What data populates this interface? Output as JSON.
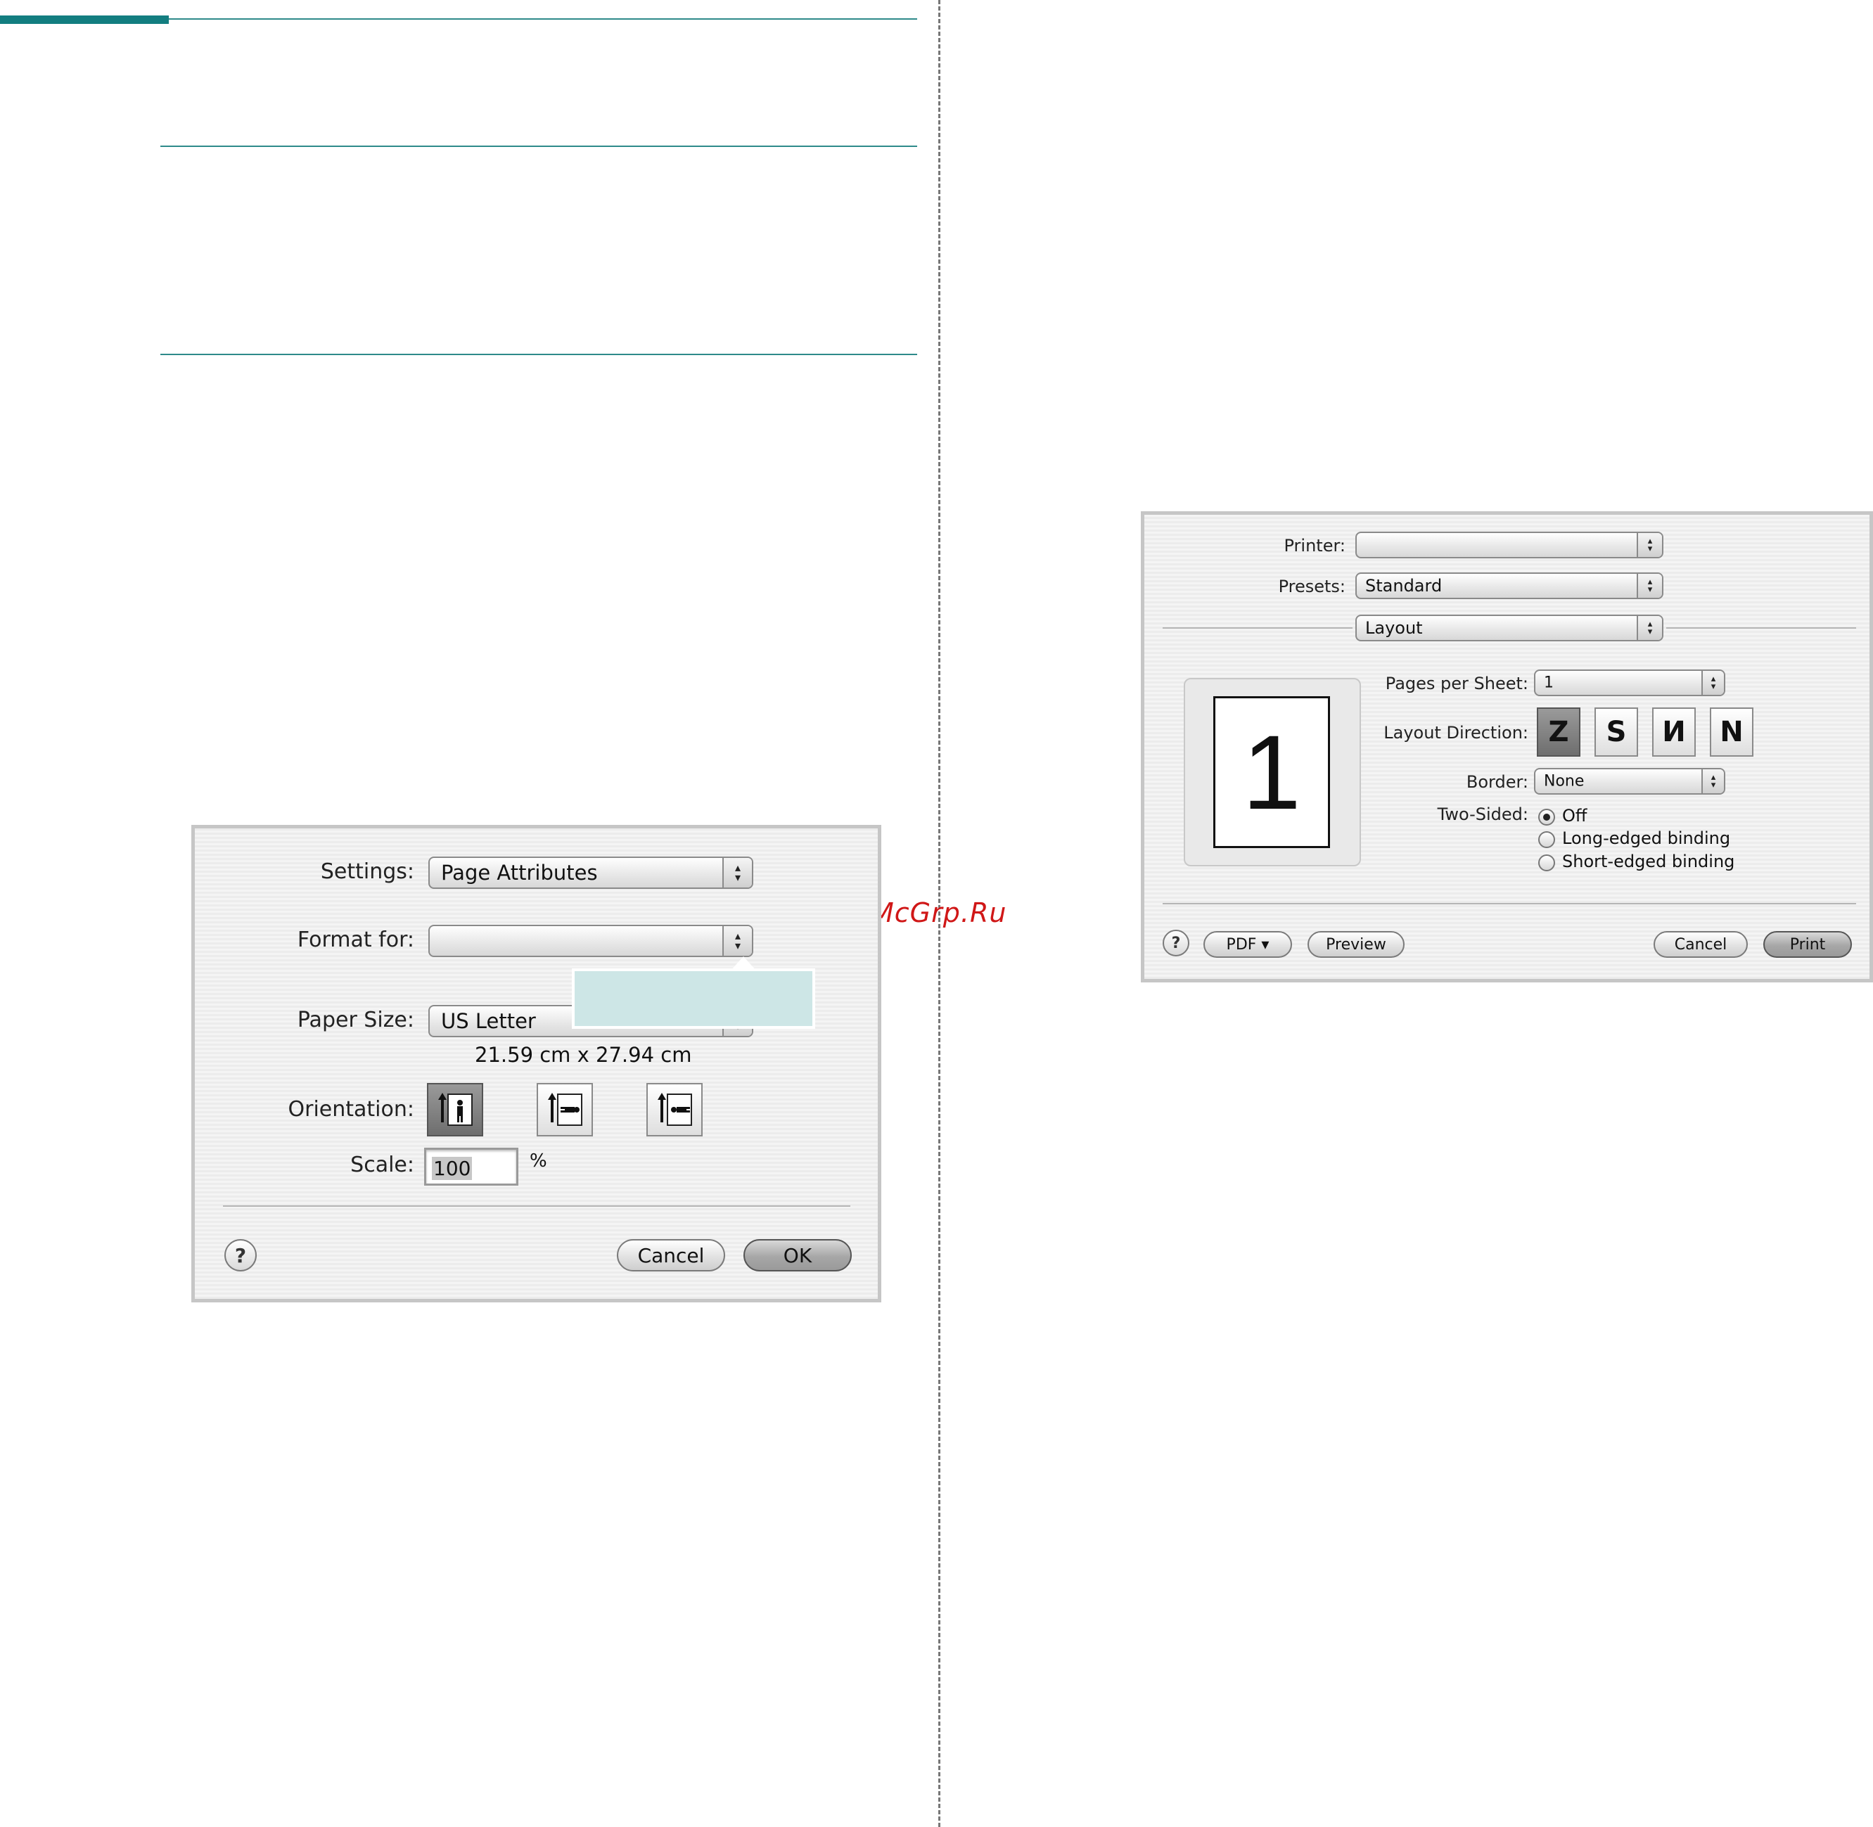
{
  "watermark": "McGrp.Ru",
  "page_setup": {
    "settings_label": "Settings:",
    "settings_value": "Page Attributes",
    "format_for_label": "Format for:",
    "format_for_value": "",
    "paper_size_label": "Paper Size:",
    "paper_size_value": "US Letter",
    "paper_dimensions": "21.59 cm x 27.94 cm",
    "orientation_label": "Orientation:",
    "scale_label": "Scale:",
    "scale_value": "100",
    "scale_unit": "%",
    "help": "?",
    "cancel": "Cancel",
    "ok": "OK"
  },
  "print_dialog": {
    "printer_label": "Printer:",
    "printer_value": "",
    "presets_label": "Presets:",
    "presets_value": "Standard",
    "panel_value": "Layout",
    "preview_page_number": "1",
    "pages_per_sheet_label": "Pages per Sheet:",
    "pages_per_sheet_value": "1",
    "layout_direction_label": "Layout Direction:",
    "layout_direction_glyphs": [
      "Z",
      "S",
      "И",
      "N"
    ],
    "border_label": "Border:",
    "border_value": "None",
    "two_sided_label": "Two-Sided:",
    "two_sided_options": [
      "Off",
      "Long-edged binding",
      "Short-edged binding"
    ],
    "two_sided_selected": "Off",
    "help": "?",
    "pdf": "PDF ▾",
    "preview": "Preview",
    "cancel": "Cancel",
    "print": "Print"
  }
}
